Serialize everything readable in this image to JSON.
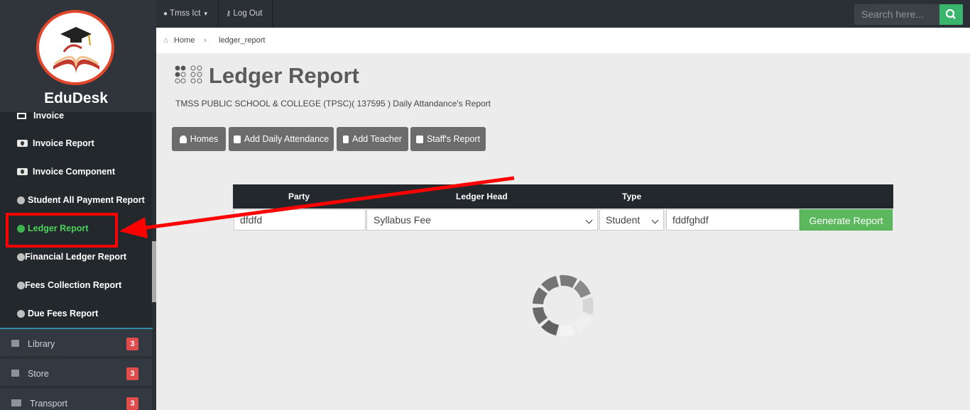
{
  "sidebar": {
    "brand": "EduDesk",
    "items": [
      {
        "label": "Invoice",
        "icon": "invoice-icon"
      },
      {
        "label": "Invoice Report",
        "icon": "money-icon"
      },
      {
        "label": "Invoice Component",
        "icon": "money-icon"
      },
      {
        "label": "Student All Payment Report",
        "icon": "circle-icon"
      },
      {
        "label": "Ledger Report",
        "icon": "circle-icon",
        "active": true
      },
      {
        "label": "Financial Ledger Report",
        "icon": "circle-icon"
      },
      {
        "label": "Fees Collection Report",
        "icon": "circle-icon"
      },
      {
        "label": "Due Fees Report",
        "icon": "circle-icon"
      }
    ],
    "groups": [
      {
        "label": "Library",
        "badge": "3"
      },
      {
        "label": "Store",
        "badge": "3"
      },
      {
        "label": "Transport",
        "badge": "3"
      }
    ]
  },
  "topbar": {
    "user": "Tmss Ict",
    "logout": "Log Out",
    "search_placeholder": "Search here..."
  },
  "breadcrumb": {
    "home": "Home",
    "current": "ledger_report"
  },
  "page": {
    "title": "Ledger Report",
    "subtitle": "TMSS PUBLIC SCHOOL & COLLEGE (TPSC)( 137595 ) Daily Attandance's Report",
    "buttons": [
      "Homes",
      "Add Daily Attendance",
      "Add Teacher",
      "Staff's Report"
    ]
  },
  "form": {
    "headers": {
      "party": "Party",
      "ledger_head": "Ledger Head",
      "type": "Type"
    },
    "party_value": "dfdfd",
    "ledger_head_value": "Syllabus Fee",
    "type_value": "Student",
    "extra_value": "fddfghdf",
    "submit": "Generate Report"
  },
  "colors": {
    "accent_green": "#5cb85c",
    "search_green": "#3ab56e",
    "sidebar_bg": "#23282d",
    "annotation_red": "#ff0000"
  }
}
